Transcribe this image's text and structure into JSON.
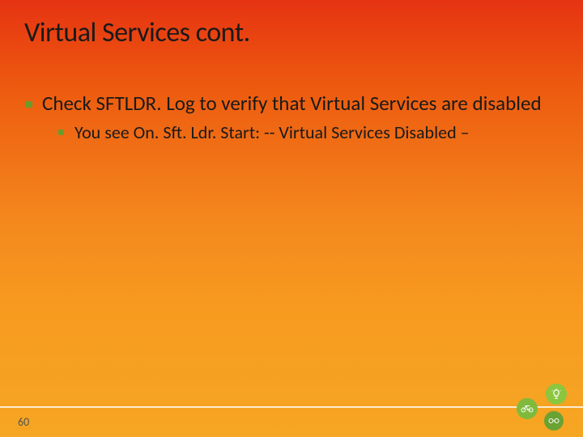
{
  "title": "Virtual Services cont.",
  "bullets": {
    "l1": "Check SFTLDR. Log to verify that Virtual Services are disabled",
    "l2": "You see On. Sft. Ldr. Start: -- Virtual Services Disabled –"
  },
  "slide_number": "60"
}
